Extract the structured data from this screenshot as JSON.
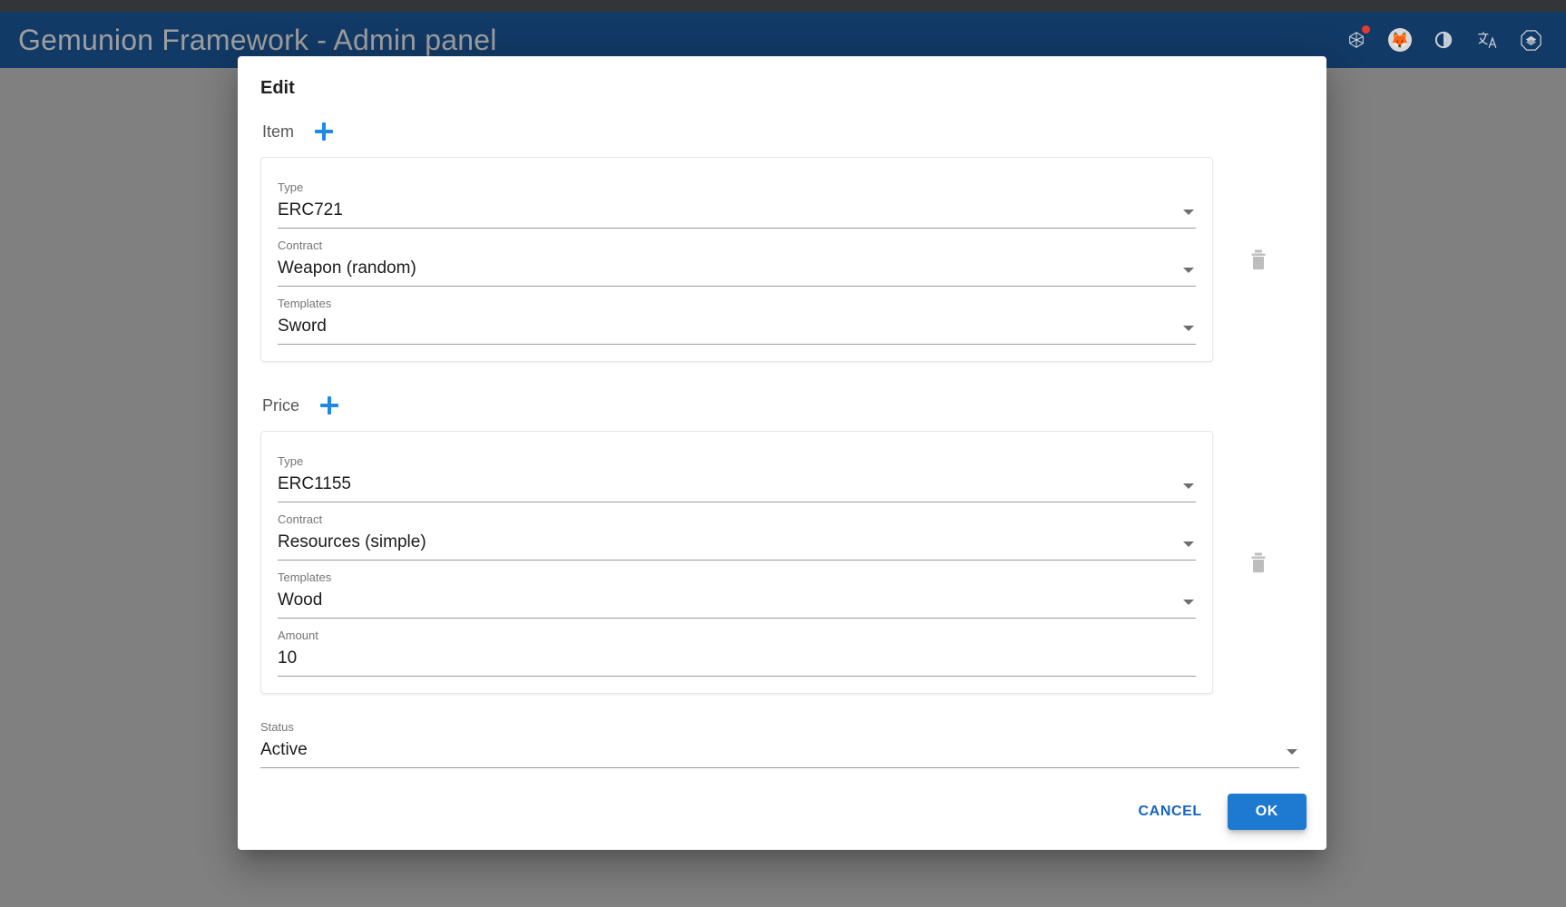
{
  "colors": {
    "app_bar": "#123a66",
    "accent_blue": "#1e88e5",
    "primary_button": "#1e7ad1",
    "scrim": "#808080"
  },
  "app_bar": {
    "title": "Gemunion Framework - Admin panel",
    "extensions": [
      {
        "name": "network-graph-icon",
        "glyph": "⬡",
        "has_badge": true
      },
      {
        "name": "metamask-fox-icon",
        "glyph": "🦊",
        "has_badge": false
      },
      {
        "name": "dark-mode-icon",
        "glyph": "◑",
        "has_badge": false
      },
      {
        "name": "translate-icon",
        "glyph": "文",
        "has_badge": false
      },
      {
        "name": "ublock-origin-icon",
        "glyph": "⬣",
        "has_badge": false
      }
    ]
  },
  "dialog": {
    "title": "Edit",
    "sections": [
      {
        "label": "Item",
        "add_label": "+",
        "fields": [
          {
            "label": "Type",
            "value": "ERC721",
            "control": "select"
          },
          {
            "label": "Contract",
            "value": "Weapon (random)",
            "control": "select"
          },
          {
            "label": "Templates",
            "value": "Sword",
            "control": "select"
          }
        ]
      },
      {
        "label": "Price",
        "add_label": "+",
        "fields": [
          {
            "label": "Type",
            "value": "ERC1155",
            "control": "select"
          },
          {
            "label": "Contract",
            "value": "Resources (simple)",
            "control": "select"
          },
          {
            "label": "Templates",
            "value": "Wood",
            "control": "select"
          },
          {
            "label": "Amount",
            "value": "10",
            "control": "text"
          }
        ]
      }
    ],
    "status": {
      "label": "Status",
      "value": "Active",
      "control": "select"
    },
    "actions": {
      "cancel_label": "CANCEL",
      "ok_label": "OK"
    }
  }
}
